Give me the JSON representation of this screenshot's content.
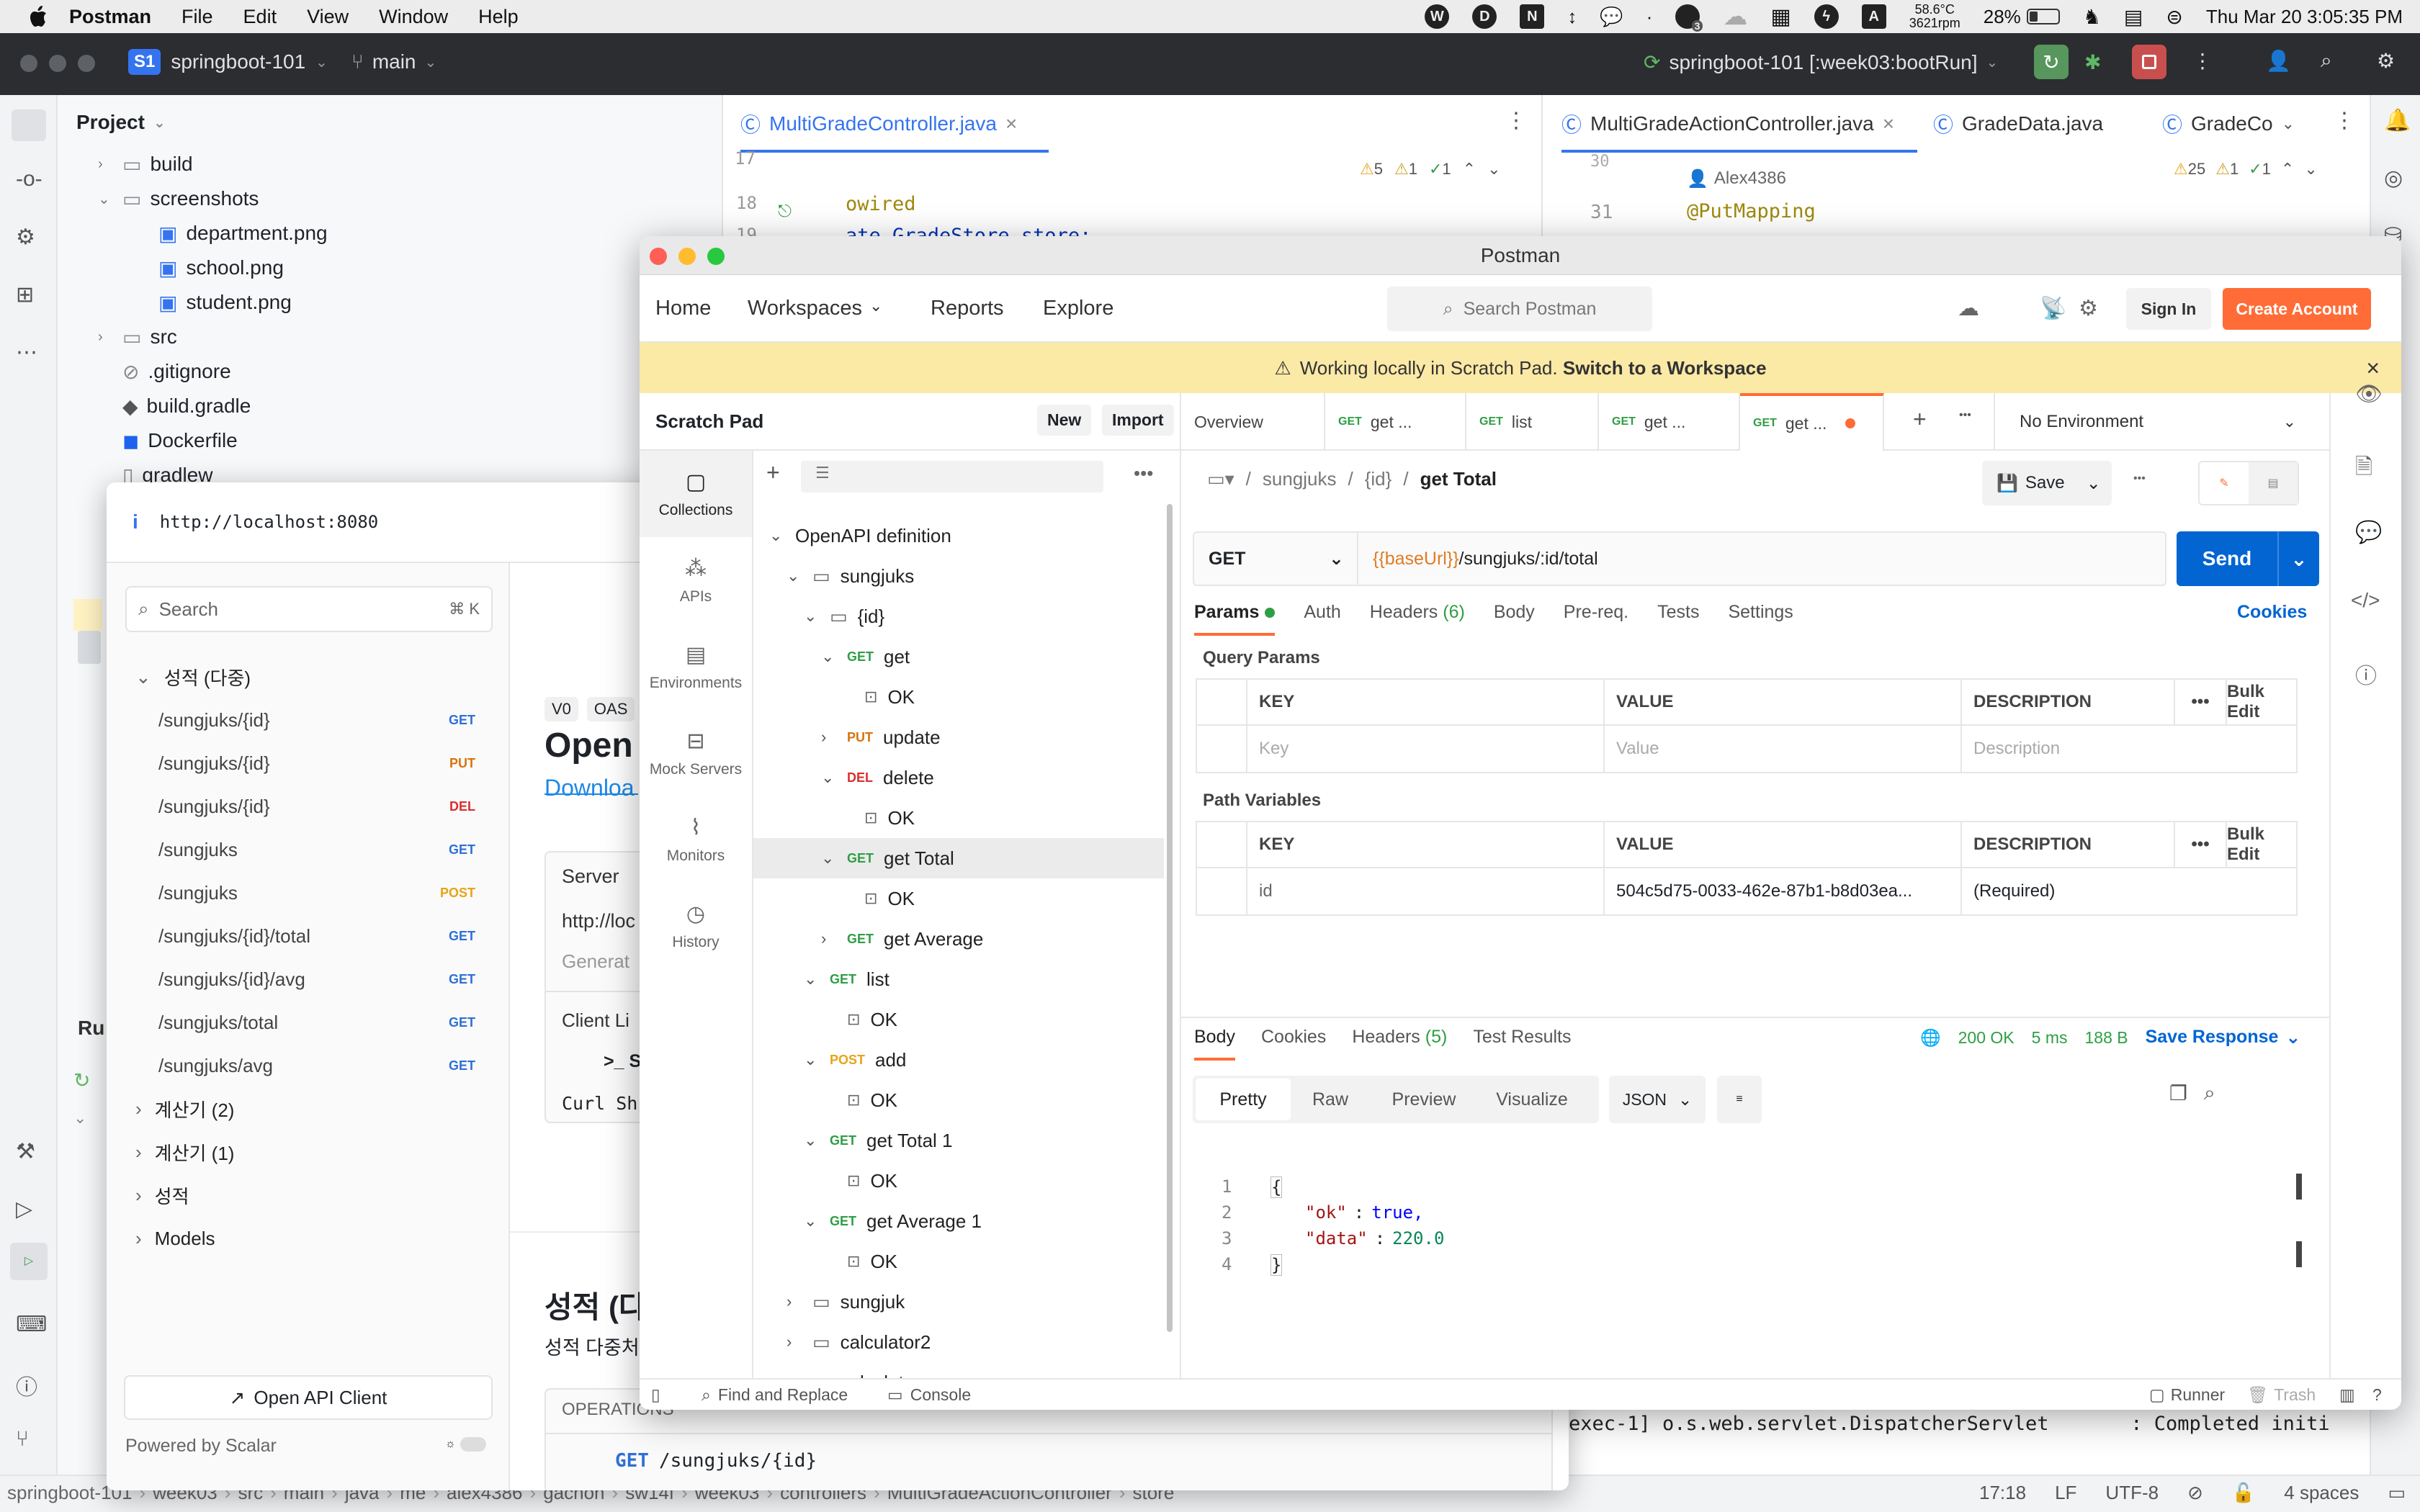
{
  "menubar": {
    "app": "Postman",
    "items": [
      "File",
      "Edit",
      "View",
      "Window",
      "Help"
    ],
    "temp": "58.6°C",
    "rpm": "3621rpm",
    "battery": "28%",
    "datetime": "Thu Mar 20  3:05:35 PM",
    "badge": "3"
  },
  "ide": {
    "project_badge": "S1",
    "project": "springboot-101",
    "branch": "main",
    "run_config": "springboot-101 [:week03:bootRun]",
    "project_panel_title": "Project",
    "tree": [
      {
        "label": "build",
        "depth": 1,
        "expanded": false,
        "kind": "folder"
      },
      {
        "label": "screenshots",
        "depth": 1,
        "expanded": true,
        "kind": "folder"
      },
      {
        "label": "department.png",
        "depth": 2,
        "kind": "image"
      },
      {
        "label": "school.png",
        "depth": 2,
        "kind": "image"
      },
      {
        "label": "student.png",
        "depth": 2,
        "kind": "image"
      },
      {
        "label": "src",
        "depth": 1,
        "expanded": false,
        "kind": "folder"
      },
      {
        "label": ".gitignore",
        "depth": 1,
        "kind": "ignore"
      },
      {
        "label": "build.gradle",
        "depth": 1,
        "kind": "gradle"
      },
      {
        "label": "Dockerfile",
        "depth": 1,
        "kind": "docker"
      },
      {
        "label": "gradlew",
        "depth": 1,
        "kind": "file"
      }
    ],
    "editor1": {
      "tab": "MultiGradeController.java",
      "warn": "5",
      "weak": "1",
      "ok": "1",
      "lines": [
        {
          "n": "17",
          "code": ""
        },
        {
          "n": "18",
          "code": "owired"
        },
        {
          "n": "19",
          "code": "ate GradeStore store;"
        }
      ]
    },
    "editor2": {
      "tabs": [
        "MultiGradeActionController.java",
        "GradeData.java",
        "GradeCo"
      ],
      "warn": "25",
      "weak": "1",
      "ok": "1",
      "line_num": "31",
      "author": "Alex4386",
      "annotation": "@PutMapping",
      "top_line": "30"
    },
    "console_line": "exec-1] o.s.web.servlet.DispatcherServlet       : Completed initi",
    "run_label": "Ru",
    "status": {
      "breadcrumb": [
        "springboot-101",
        "week03",
        "src",
        "main",
        "java",
        "me",
        "alex4386",
        "gachon",
        "sw14f",
        "week03",
        "controllers",
        "MultiGradeActionController",
        "store"
      ],
      "position": "17:18",
      "eol": "LF",
      "encoding": "UTF-8",
      "indent": "4 spaces"
    }
  },
  "postman": {
    "window_title": "Postman",
    "nav": {
      "items": [
        "Home",
        "Workspaces",
        "Reports",
        "Explore"
      ],
      "search_placeholder": "Search Postman",
      "sign_in": "Sign In",
      "create_account": "Create Account"
    },
    "banner": {
      "text": "Working locally in Scratch Pad.",
      "link": "Switch to a Workspace"
    },
    "sidebar": {
      "title": "Scratch Pad",
      "new": "New",
      "import": "Import",
      "rail": [
        "Collections",
        "APIs",
        "Environments",
        "Mock Servers",
        "Monitors",
        "History"
      ]
    },
    "tree": [
      {
        "label": "OpenAPI definition",
        "depth": 0,
        "chev": "down",
        "kind": "collection"
      },
      {
        "label": "sungjuks",
        "depth": 1,
        "chev": "down",
        "kind": "folder"
      },
      {
        "label": "{id}",
        "depth": 2,
        "chev": "down",
        "kind": "folder"
      },
      {
        "label": "get",
        "depth": 3,
        "chev": "down",
        "method": "GET"
      },
      {
        "label": "OK",
        "depth": 4,
        "kind": "example"
      },
      {
        "label": "update",
        "depth": 3,
        "chev": "right",
        "method": "PUT"
      },
      {
        "label": "delete",
        "depth": 3,
        "chev": "down",
        "method": "DEL"
      },
      {
        "label": "OK",
        "depth": 4,
        "kind": "example"
      },
      {
        "label": "get Total",
        "depth": 3,
        "chev": "down",
        "method": "GET",
        "selected": true
      },
      {
        "label": "OK",
        "depth": 4,
        "kind": "example"
      },
      {
        "label": "get Average",
        "depth": 3,
        "chev": "right",
        "method": "GET"
      },
      {
        "label": "list",
        "depth": 2,
        "chev": "down",
        "method": "GET"
      },
      {
        "label": "OK",
        "depth": 3,
        "kind": "example"
      },
      {
        "label": "add",
        "depth": 2,
        "chev": "down",
        "method": "POST"
      },
      {
        "label": "OK",
        "depth": 3,
        "kind": "example"
      },
      {
        "label": "get Total 1",
        "depth": 2,
        "chev": "down",
        "method": "GET"
      },
      {
        "label": "OK",
        "depth": 3,
        "kind": "example"
      },
      {
        "label": "get Average 1",
        "depth": 2,
        "chev": "down",
        "method": "GET"
      },
      {
        "label": "OK",
        "depth": 3,
        "kind": "example"
      },
      {
        "label": "sungjuk",
        "depth": 1,
        "chev": "right",
        "kind": "folder"
      },
      {
        "label": "calculator2",
        "depth": 1,
        "chev": "right",
        "kind": "folder"
      },
      {
        "label": "calculator",
        "depth": 1,
        "chev": "right",
        "kind": "folder"
      }
    ],
    "tabs": [
      {
        "label": "Overview"
      },
      {
        "method": "GET",
        "label": "get ..."
      },
      {
        "method": "GET",
        "label": "list"
      },
      {
        "method": "GET",
        "label": "get ..."
      },
      {
        "method": "GET",
        "label": "get ...",
        "active": true
      }
    ],
    "environment": "No Environment",
    "breadcrumb": [
      "sungjuks",
      "{id}"
    ],
    "request_name": "get Total",
    "save": "Save",
    "method": "GET",
    "url_var": "{{baseUrl}}",
    "url_path": "/sungjuks/:id/total",
    "send": "Send",
    "req_tabs": [
      "Params",
      "Auth",
      "Headers",
      "Body",
      "Pre-req.",
      "Tests",
      "Settings"
    ],
    "headers_count": "(6)",
    "cookies": "Cookies",
    "query_params": {
      "title": "Query Params",
      "cols": [
        "KEY",
        "VALUE",
        "DESCRIPTION"
      ],
      "bulk": "Bulk Edit",
      "ph": [
        "Key",
        "Value",
        "Description"
      ]
    },
    "path_vars": {
      "title": "Path Variables",
      "cols": [
        "KEY",
        "VALUE",
        "DESCRIPTION"
      ],
      "bulk": "Bulk Edit",
      "row": [
        "id",
        "504c5d75-0033-462e-87b1-b8d03ea...",
        "(Required)"
      ]
    },
    "resp_tabs": [
      "Body",
      "Cookies",
      "Headers",
      "Test Results"
    ],
    "resp_headers_count": "(5)",
    "status": "200 OK",
    "time": "5 ms",
    "size": "188 B",
    "save_response": "Save Response",
    "views": [
      "Pretty",
      "Raw",
      "Preview",
      "Visualize"
    ],
    "format": "JSON",
    "body_lines": [
      {
        "n": "1",
        "text": "{"
      },
      {
        "n": "2",
        "key": "\"ok\"",
        "val": "true,"
      },
      {
        "n": "3",
        "key": "\"data\"",
        "val": "220.0"
      },
      {
        "n": "4",
        "text": "}"
      }
    ],
    "footer": {
      "find": "Find and Replace",
      "console": "Console",
      "runner": "Runner",
      "trash": "Trash"
    }
  },
  "scalar": {
    "url": "http://localhost:8080",
    "search_placeholder": "Search",
    "search_kbd": "⌘ K",
    "group_open": "성적 (다중)",
    "endpoints": [
      {
        "path": "/sungjuks/{id}",
        "verb": "GET"
      },
      {
        "path": "/sungjuks/{id}",
        "verb": "PUT"
      },
      {
        "path": "/sungjuks/{id}",
        "verb": "DEL"
      },
      {
        "path": "/sungjuks",
        "verb": "GET"
      },
      {
        "path": "/sungjuks",
        "verb": "POST"
      },
      {
        "path": "/sungjuks/{id}/total",
        "verb": "GET"
      },
      {
        "path": "/sungjuks/{id}/avg",
        "verb": "GET"
      },
      {
        "path": "/sungjuks/total",
        "verb": "GET"
      },
      {
        "path": "/sungjuks/avg",
        "verb": "GET"
      }
    ],
    "groups": [
      "계산기 (2)",
      "계산기 (1)",
      "성적",
      "Models"
    ],
    "open_client": "Open API Client",
    "powered": "Powered by Scalar",
    "main": {
      "v0": "V0",
      "oas": "OAS",
      "title": "Open",
      "download": "Downloa",
      "server": "Server",
      "server_url": "http://loc",
      "generate": "Generat",
      "client": "Client Li",
      "shell": ">_ S",
      "curl": "Curl Sh",
      "section_title": "성적 (다",
      "section_desc": "성적 다중처",
      "operations": "OPERATIONS",
      "op_verb": "GET",
      "op_path": "/sungjuks/{id}"
    }
  },
  "colors": {
    "get": "#2f9e44",
    "put": "#d9730d",
    "del": "#d92f2f",
    "post": "#e8a317",
    "pm_orange": "#ff6c37",
    "pm_blue": "#0265d2"
  }
}
